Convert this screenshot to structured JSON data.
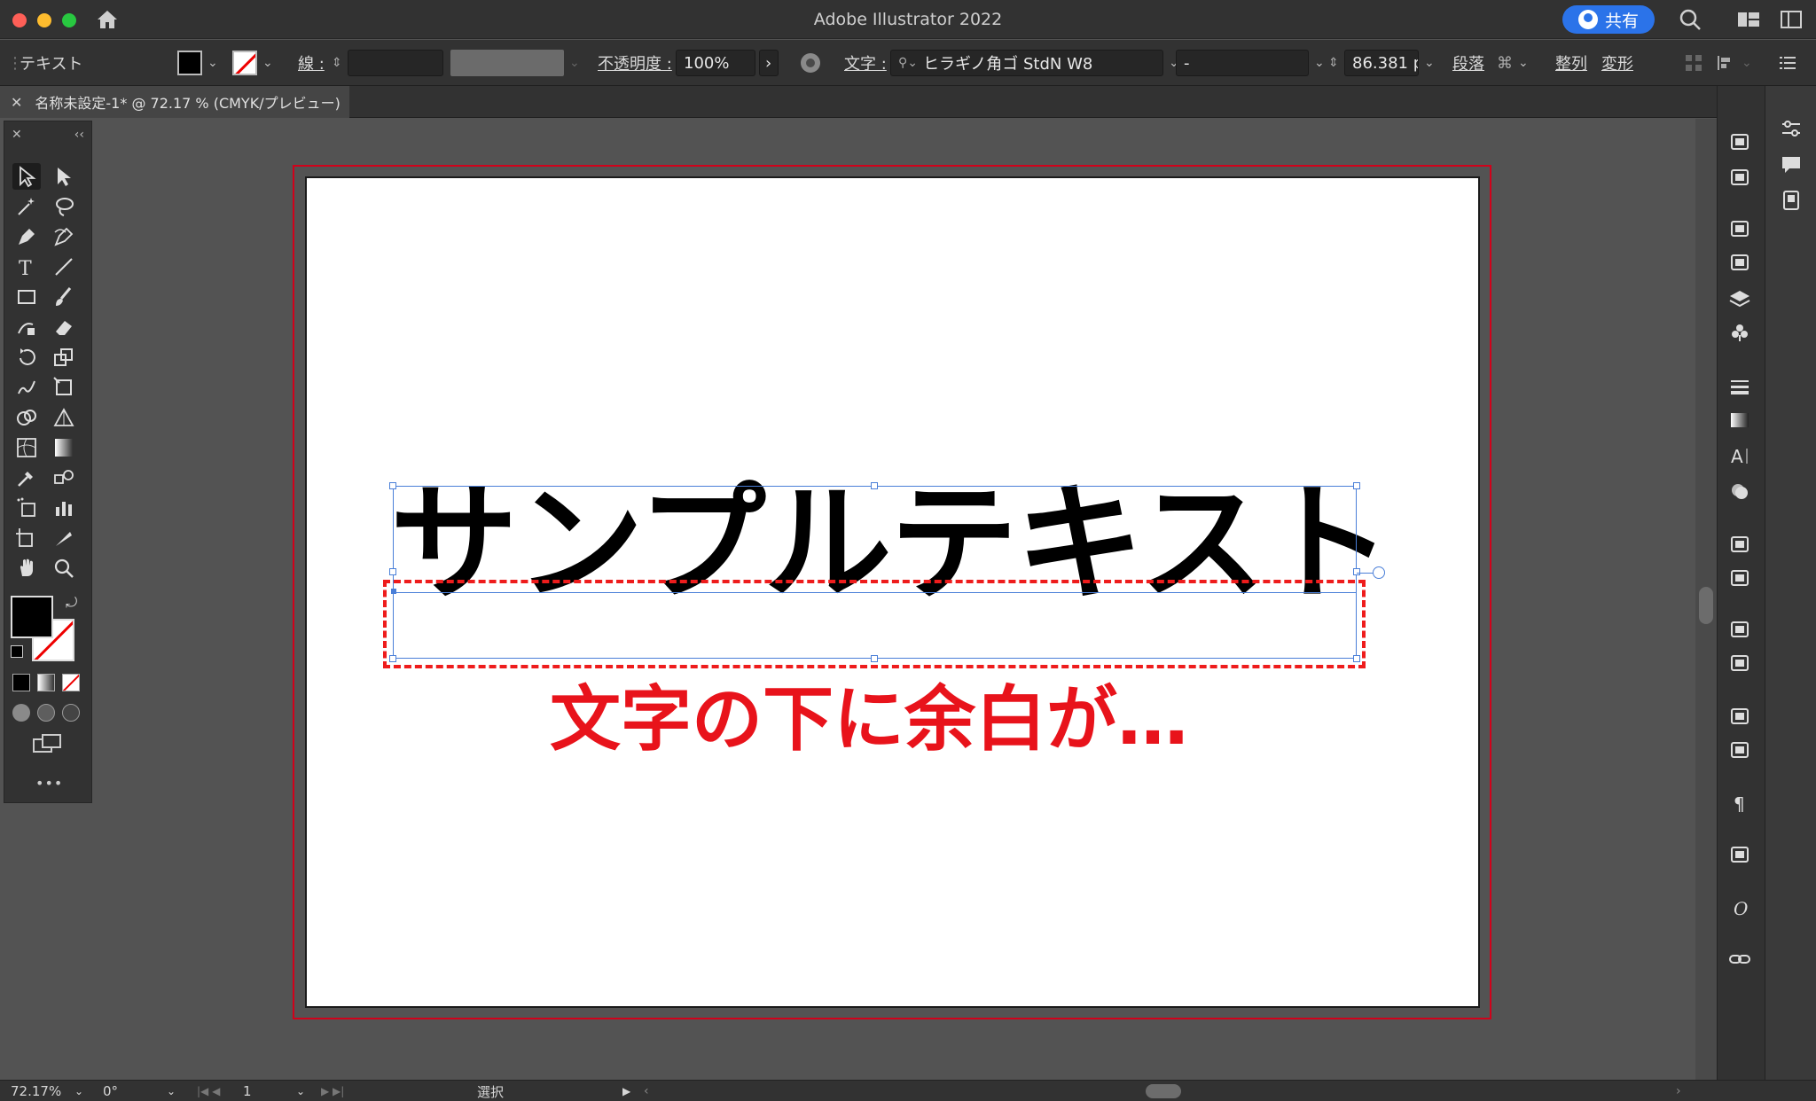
{
  "window": {
    "title": "Adobe Illustrator 2022",
    "share_label": "共有"
  },
  "control_bar": {
    "selection_type": "テキスト",
    "stroke_label": "線 :",
    "opacity_label": "不透明度 :",
    "opacity_value": "100%",
    "character_label": "文字 :",
    "font_family": "ヒラギノ角ゴ StdN W8",
    "font_style": "-",
    "font_size": "86.381 p",
    "paragraph_label": "段落",
    "align_label": "整列",
    "transform_label": "変形"
  },
  "document_tab": {
    "title": "名称未設定-1* @ 72.17 % (CMYK/プレビュー)"
  },
  "artboard": {
    "sample_text": "サンプルテキスト",
    "annotation_text": "文字の下に余白が…",
    "annotation_color": "#e8131b",
    "selection_color": "#4a7fd8",
    "bleed_color": "#d0021b"
  },
  "status_bar": {
    "zoom": "72.17%",
    "rotation": "0°",
    "artboard_number": "1",
    "tool_name": "選択"
  },
  "toolbar": {
    "more_label": "•••",
    "tools": [
      "selection-tool",
      "direct-selection-tool",
      "magic-wand-tool",
      "lasso-tool",
      "pen-tool",
      "curvature-tool",
      "type-tool",
      "line-segment-tool",
      "rectangle-tool",
      "paintbrush-tool",
      "shaper-tool",
      "eraser-tool",
      "rotate-tool",
      "scale-tool",
      "warp-tool",
      "free-transform-tool",
      "shape-builder-tool",
      "perspective-grid-tool",
      "mesh-tool",
      "gradient-tool",
      "eyedropper-tool",
      "blend-tool",
      "symbol-sprayer-tool",
      "column-graph-tool",
      "artboard-tool",
      "slice-tool",
      "hand-tool",
      "zoom-tool"
    ]
  }
}
